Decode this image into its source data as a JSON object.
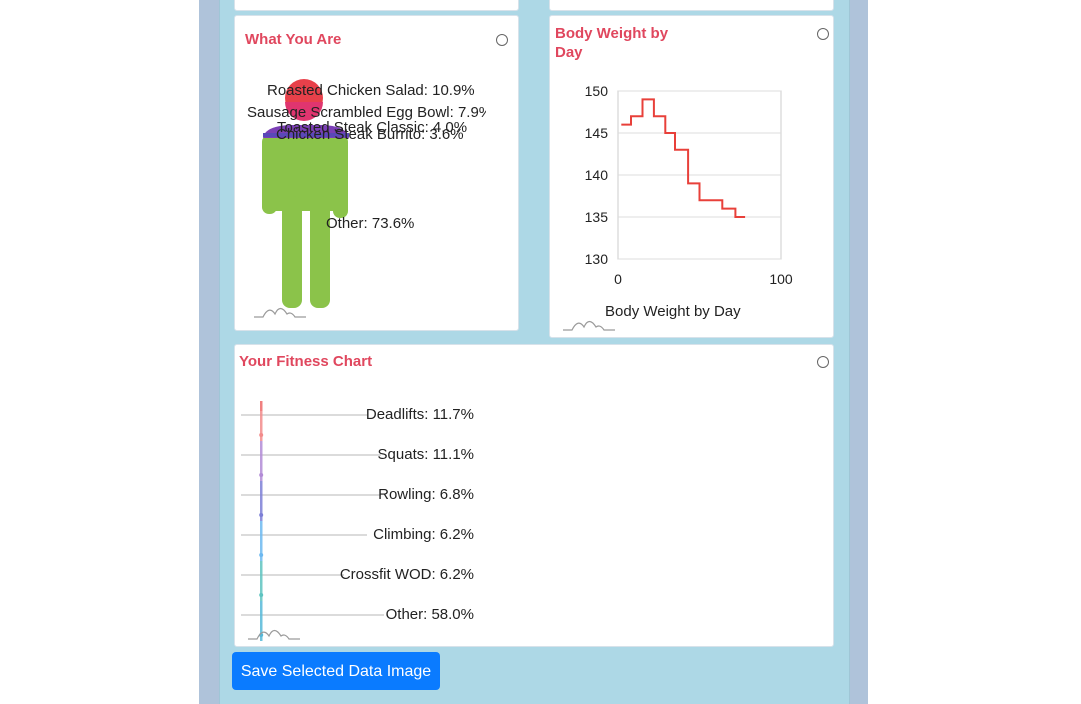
{
  "cards": {
    "what_you_are": {
      "title": "What You Are",
      "labels": [
        "Roasted Chicken Salad: 10.9%",
        "Sausage Scrambled Egg Bowl: 7.9%",
        "Toasted Steak Classic: 4.0%",
        "Chicken Steak Burrito: 3.6%",
        "Other: 73.6%"
      ]
    },
    "body_weight": {
      "title": "Body Weight by Day",
      "caption": "Body Weight by Day"
    },
    "fitness": {
      "title": "Your Fitness Chart",
      "labels": [
        "Deadlifts: 11.7%",
        "Squats: 11.1%",
        "Rowling: 6.8%",
        "Climbing: 6.2%",
        "Crossfit WOD: 6.2%",
        "Other: 58.0%"
      ]
    }
  },
  "save_button": "Save Selected Data Image",
  "chart_data": [
    {
      "type": "pie",
      "title": "What You Are",
      "categories": [
        "Roasted Chicken Salad",
        "Sausage Scrambled Egg Bowl",
        "Toasted Steak Classic",
        "Chicken Steak Burrito",
        "Other"
      ],
      "values": [
        10.9,
        7.9,
        4.0,
        3.6,
        73.6
      ],
      "colors": [
        "#e8404a",
        "#e0356f",
        "#8e3fb3",
        "#6a44b8",
        "#8bc34a"
      ]
    },
    {
      "type": "line",
      "title": "Body Weight by Day",
      "xlabel": "Body Weight by Day",
      "xlim": [
        0,
        100
      ],
      "ylim": [
        130,
        150
      ],
      "xticks": [
        "0",
        "100"
      ],
      "yticks": [
        "150",
        "145",
        "140",
        "135",
        "130"
      ],
      "series": [
        {
          "color": "#e8403a",
          "x": [
            2,
            8,
            8,
            15,
            15,
            22,
            22,
            29,
            29,
            35,
            35,
            43,
            43,
            50,
            50,
            57,
            57,
            64,
            64,
            72,
            72,
            78
          ],
          "y": [
            146,
            146,
            147,
            147,
            149,
            149,
            147,
            147,
            145,
            145,
            143,
            143,
            139,
            139,
            137,
            137,
            137,
            137,
            136,
            136,
            135,
            135
          ]
        }
      ]
    },
    {
      "type": "bar",
      "title": "Your Fitness Chart",
      "categories": [
        "Deadlifts",
        "Squats",
        "Rowling",
        "Climbing",
        "Crossfit WOD",
        "Other"
      ],
      "values": [
        11.7,
        11.1,
        6.8,
        6.2,
        6.2,
        58.0
      ],
      "colors": [
        "#f28b8b",
        "#b28bd6",
        "#7d7fd6",
        "#6cb8f0",
        "#5ec3c0",
        "#56b8d8"
      ]
    }
  ]
}
